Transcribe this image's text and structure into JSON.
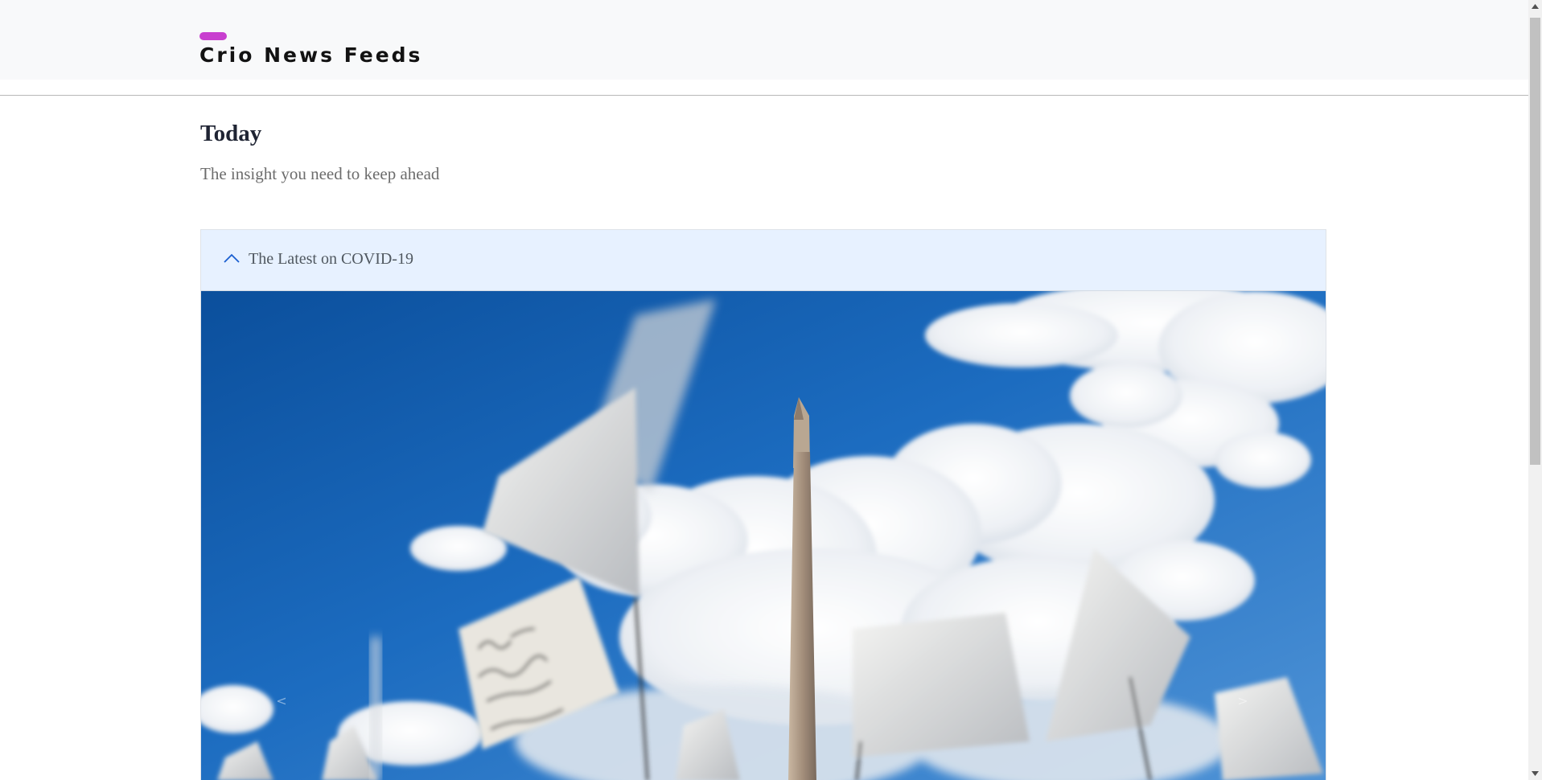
{
  "navbar": {
    "brand": "Crio News Feeds",
    "accent_color": "#c83fcf"
  },
  "main": {
    "heading": "Today",
    "subheading": "The insight you need to keep ahead"
  },
  "accordion": {
    "title": "The Latest on COVID-19",
    "expanded": true,
    "chevron_icon": "chevron-up-icon",
    "carousel": {
      "prev_label": "<",
      "next_label": ">"
    }
  }
}
